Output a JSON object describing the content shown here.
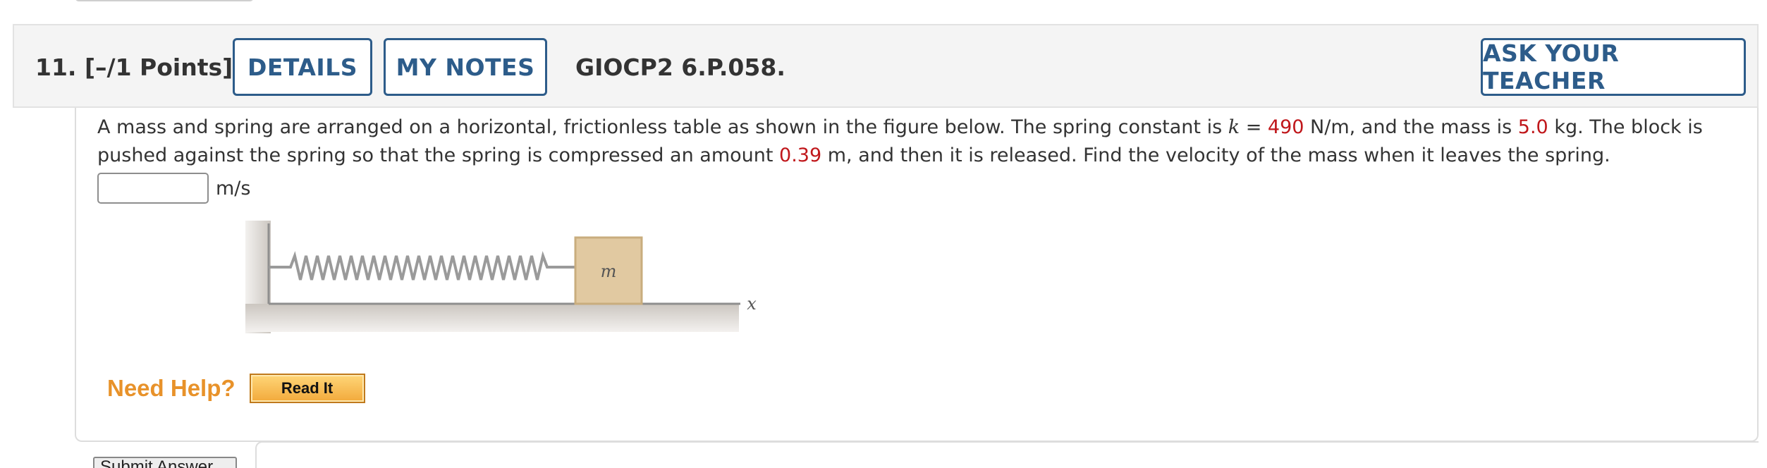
{
  "question": {
    "number": "11.",
    "points": "[–/1 Points]",
    "details_label": "DETAILS",
    "notes_label": "MY NOTES",
    "code": "GIOCP2 6.P.058.",
    "ask_label": "ASK YOUR TEACHER"
  },
  "problem": {
    "t1": "A mass and spring are arranged on a horizontal, frictionless table as shown in the figure below. The spring constant is ",
    "k_symbol": "k",
    "t2": " = ",
    "k_value": "490",
    "t3": " N/m, and the mass is ",
    "mass_value": "5.0",
    "t4": " kg. The block is pushed against the spring so that the spring is compressed an amount ",
    "compression_value": "0.39",
    "t5": " m, and then it is released. Find the velocity of the mass when it leaves the spring."
  },
  "answer": {
    "value": "",
    "unit": "m/s"
  },
  "figure": {
    "mass_label": "m",
    "axis_label": "x"
  },
  "help": {
    "label": "Need Help?",
    "read_it_label": "Read It"
  },
  "submit": {
    "label": "Submit Answer"
  },
  "colors": {
    "accent": "#2d5c8a",
    "given_value": "#c0171b",
    "help": "#e8922a"
  }
}
